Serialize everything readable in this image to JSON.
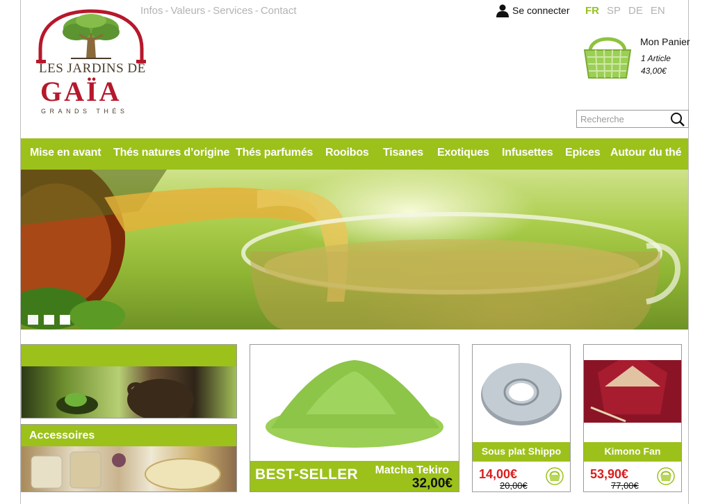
{
  "top_links": [
    {
      "label": "Infos"
    },
    {
      "label": "Valeurs"
    },
    {
      "label": "Services"
    },
    {
      "label": "Contact"
    }
  ],
  "login": {
    "label": "Se connecter",
    "icon": "user-icon"
  },
  "languages": [
    {
      "code": "FR",
      "active": true
    },
    {
      "code": "SP",
      "active": false
    },
    {
      "code": "DE",
      "active": false
    },
    {
      "code": "EN",
      "active": false
    }
  ],
  "logo": {
    "line1": "LES JARDINS DE",
    "line2": "GAÏA",
    "line3": "GRANDS THÉS"
  },
  "cart": {
    "title": "Mon Panier",
    "items": "1 Article",
    "total": "43,00€",
    "icon": "basket-icon"
  },
  "search": {
    "placeholder": "Recherche",
    "icon": "search-icon"
  },
  "nav": [
    {
      "label": "Mise en avant"
    },
    {
      "label": "Thés natures d’origine"
    },
    {
      "label": "Thés parfumés"
    },
    {
      "label": "Rooibos"
    },
    {
      "label": "Tisanes"
    },
    {
      "label": "Exotiques"
    },
    {
      "label": "Infusettes"
    },
    {
      "label": "Epices"
    },
    {
      "label": "Autour du thé"
    }
  ],
  "slider": {
    "slide_count": 3,
    "active_index": 0
  },
  "promos": [
    {
      "label": ""
    },
    {
      "label": "Accessoires"
    }
  ],
  "best_seller": {
    "tag": "BEST-SELLER",
    "name": "Matcha Tekiro",
    "price": "32,00€"
  },
  "products": [
    {
      "name": "Sous plat Shippo",
      "price": "14,00€",
      "old_price": "20,00€"
    },
    {
      "name": "Kimono Fan",
      "price": "53,90€",
      "old_price": "77,00€"
    }
  ],
  "colors": {
    "accent": "#9cc11b",
    "price_red": "#d91e1e",
    "muted": "#b3b3b3"
  }
}
